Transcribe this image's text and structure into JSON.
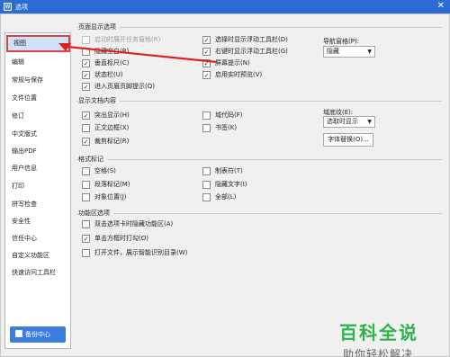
{
  "window": {
    "title": "选项",
    "close_glyph": "✕",
    "app_icon": "W"
  },
  "sidebar": {
    "items": [
      {
        "label": "视图",
        "active": true
      },
      {
        "label": "编辑"
      },
      {
        "label": "常规与保存"
      },
      {
        "label": "文件位置"
      },
      {
        "label": "修订"
      },
      {
        "label": "中文版式"
      },
      {
        "label": "输出PDF"
      },
      {
        "label": "用户信息"
      },
      {
        "label": "打印"
      },
      {
        "label": "拼写检查"
      },
      {
        "label": "安全性"
      },
      {
        "label": "信任中心"
      },
      {
        "label": "自定义功能区"
      },
      {
        "label": "快速访问工具栏"
      }
    ],
    "backup_label": "备份中心"
  },
  "page_display": {
    "title": "页面显示选项",
    "left": [
      {
        "label": "启动时展开任务窗格(R)",
        "checked": false,
        "disabled": true
      },
      {
        "label": "隐藏空白(B)",
        "checked": false
      },
      {
        "label": "垂直标尺(C)",
        "checked": true
      },
      {
        "label": "状态栏(U)",
        "checked": true
      },
      {
        "label": "进入页眉页脚提示(Q)",
        "checked": true
      }
    ],
    "right": [
      {
        "label": "选择时显示浮动工具栏(D)",
        "checked": true
      },
      {
        "label": "右键时显示浮动工具栏(G)",
        "checked": true
      },
      {
        "label": "屏幕提示(N)",
        "checked": true
      },
      {
        "label": "启用实时预览(V)",
        "checked": true
      }
    ],
    "nav_label": "导航窗格(P):",
    "nav_value": "隐藏"
  },
  "doc_content": {
    "title": "显示文档内容",
    "left": [
      {
        "label": "突出显示(H)",
        "checked": true
      },
      {
        "label": "正文边框(X)",
        "checked": false
      },
      {
        "label": "裁剪标记(R)",
        "checked": true
      }
    ],
    "right": [
      {
        "label": "域代码(F)",
        "checked": false
      },
      {
        "label": "书签(K)",
        "checked": false
      }
    ],
    "field_shading_label": "域底纹(E):",
    "field_shading_value": "选取时显示",
    "font_sub_button": "字体替换(O)..."
  },
  "format_marks": {
    "title": "格式标记",
    "left": [
      {
        "label": "空格(S)",
        "checked": false
      },
      {
        "label": "段落标记(M)",
        "checked": false
      },
      {
        "label": "对象位置(J)",
        "checked": false
      }
    ],
    "right": [
      {
        "label": "制表符(T)",
        "checked": false
      },
      {
        "label": "隐藏文字(I)",
        "checked": false
      },
      {
        "label": "全部(L)",
        "checked": false
      }
    ]
  },
  "ribbon": {
    "title": "功能区选项",
    "items": [
      {
        "label": "双击选项卡时隐藏功能区(A)",
        "checked": false
      },
      {
        "label": "单击方框时打勾(O)",
        "checked": true
      },
      {
        "label": "打开文件，展示智能识别目录(W)",
        "checked": false
      }
    ]
  },
  "watermark": {
    "top": "百科全说",
    "bottom": "助你轻松解决"
  }
}
